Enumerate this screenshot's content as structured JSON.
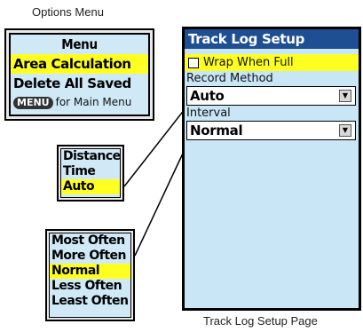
{
  "captions": {
    "options_menu": "Options Menu",
    "track_log_page": "Track Log Setup Page"
  },
  "options_menu": {
    "title": "Menu",
    "items": [
      "Area Calculation",
      "Delete All Saved"
    ],
    "selected_index": 0,
    "footer_button": "MENU",
    "footer_text": "for Main Menu"
  },
  "record_method_list": {
    "items": [
      "Distance",
      "Time",
      "Auto"
    ],
    "selected_index": 2
  },
  "interval_list": {
    "items": [
      "Most Often",
      "More Often",
      "Normal",
      "Less Often",
      "Least Often"
    ],
    "selected_index": 2
  },
  "track_log_setup": {
    "header": "Track Log Setup",
    "wrap_checkbox": {
      "label": "Wrap When Full",
      "checked": false
    },
    "record_method": {
      "label": "Record Method",
      "value": "Auto"
    },
    "interval": {
      "label": "Interval",
      "value": "Normal"
    }
  },
  "colors": {
    "header_blue": "#1e4f93",
    "highlight_yellow": "#ffff22",
    "screen_bg": "#c8e6f5"
  }
}
